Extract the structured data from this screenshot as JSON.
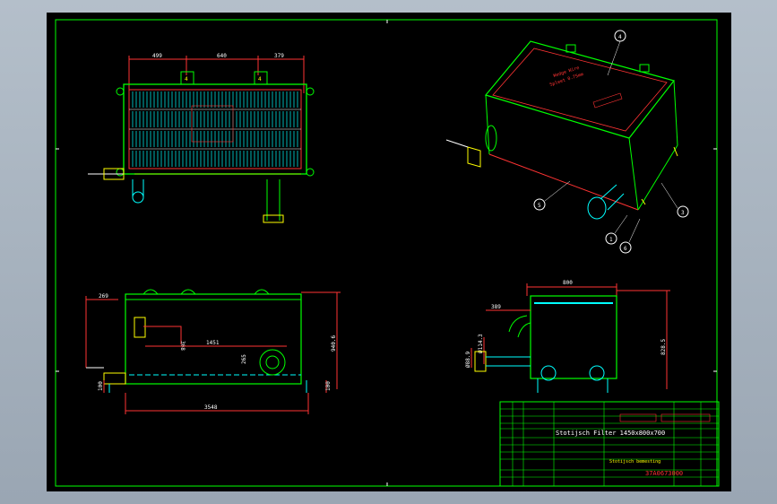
{
  "drawing": {
    "colors": {
      "background": "#000000",
      "border": "#00ff00",
      "outline": "#00ff00",
      "dimension": "#ff0000",
      "hatch": "#00ffff",
      "ink": "#ffffff",
      "accent": "#ffff00"
    },
    "plan_view": {
      "dim_left": "499",
      "dim_mid": "640",
      "dim_right": "379",
      "label_a": "4",
      "label_b": "4"
    },
    "iso_view": {
      "balloons": [
        "4",
        "5",
        "1",
        "6",
        "3"
      ]
    },
    "front_view": {
      "dim_top_left": "269",
      "dim_height_inner": "308",
      "dim_width_inner": "1451",
      "dim_small": "265",
      "dim_overall_height": "940.6",
      "dim_leg_left": "100",
      "dim_leg_right": "100",
      "dim_overall_width": "3548"
    },
    "side_view": {
      "dim_top": "800",
      "dim_left": "389",
      "dim_flange": "Ø114.3",
      "dim_pipe": "Ø88.9",
      "dim_height": "828.5"
    },
    "title_block": {
      "title": "Stotijsch Filter 1450x800x700",
      "drawing_number": "37A0673000",
      "company": "Stotijsch bemesting"
    }
  }
}
